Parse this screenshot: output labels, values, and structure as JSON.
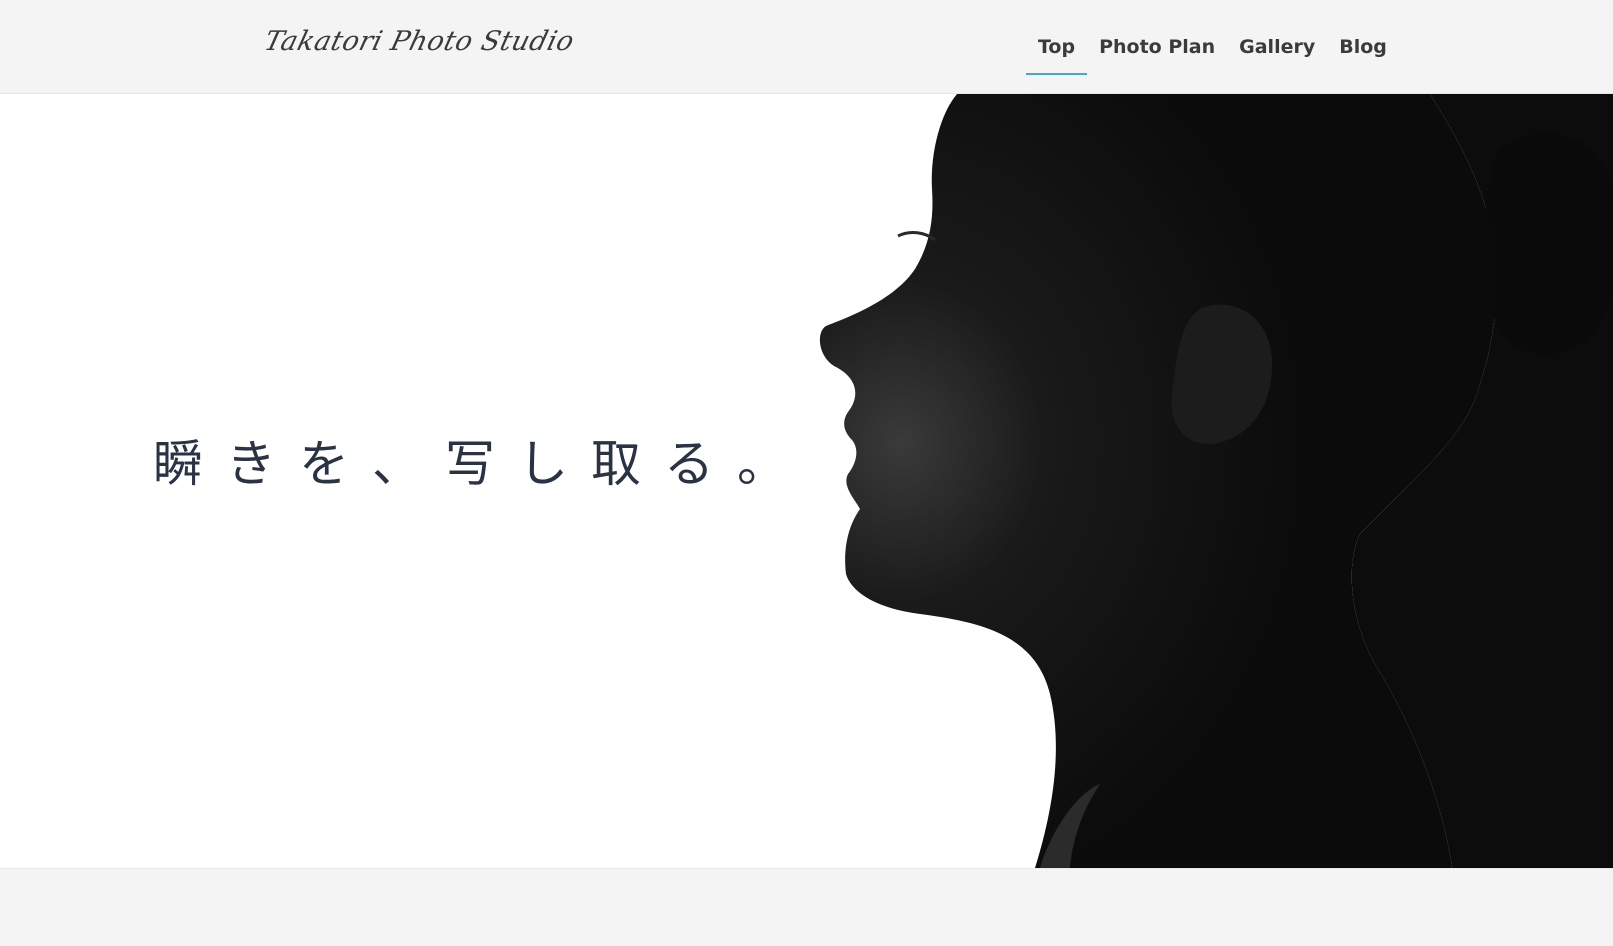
{
  "header": {
    "logo_text": "Takatori Photo Studio",
    "nav": [
      {
        "label": "Top",
        "active": true
      },
      {
        "label": "Photo Plan",
        "active": false
      },
      {
        "label": "Gallery",
        "active": false
      },
      {
        "label": "Blog",
        "active": false
      }
    ]
  },
  "hero": {
    "catchphrase": "瞬きを、写し取る。",
    "image": "profile-silhouette"
  },
  "colors": {
    "background": "#f4f4f4",
    "hero_background": "#ffffff",
    "nav_active_underline": "#47a7c4",
    "text": "#3b3b3b",
    "catch_text": "#2a3344"
  }
}
